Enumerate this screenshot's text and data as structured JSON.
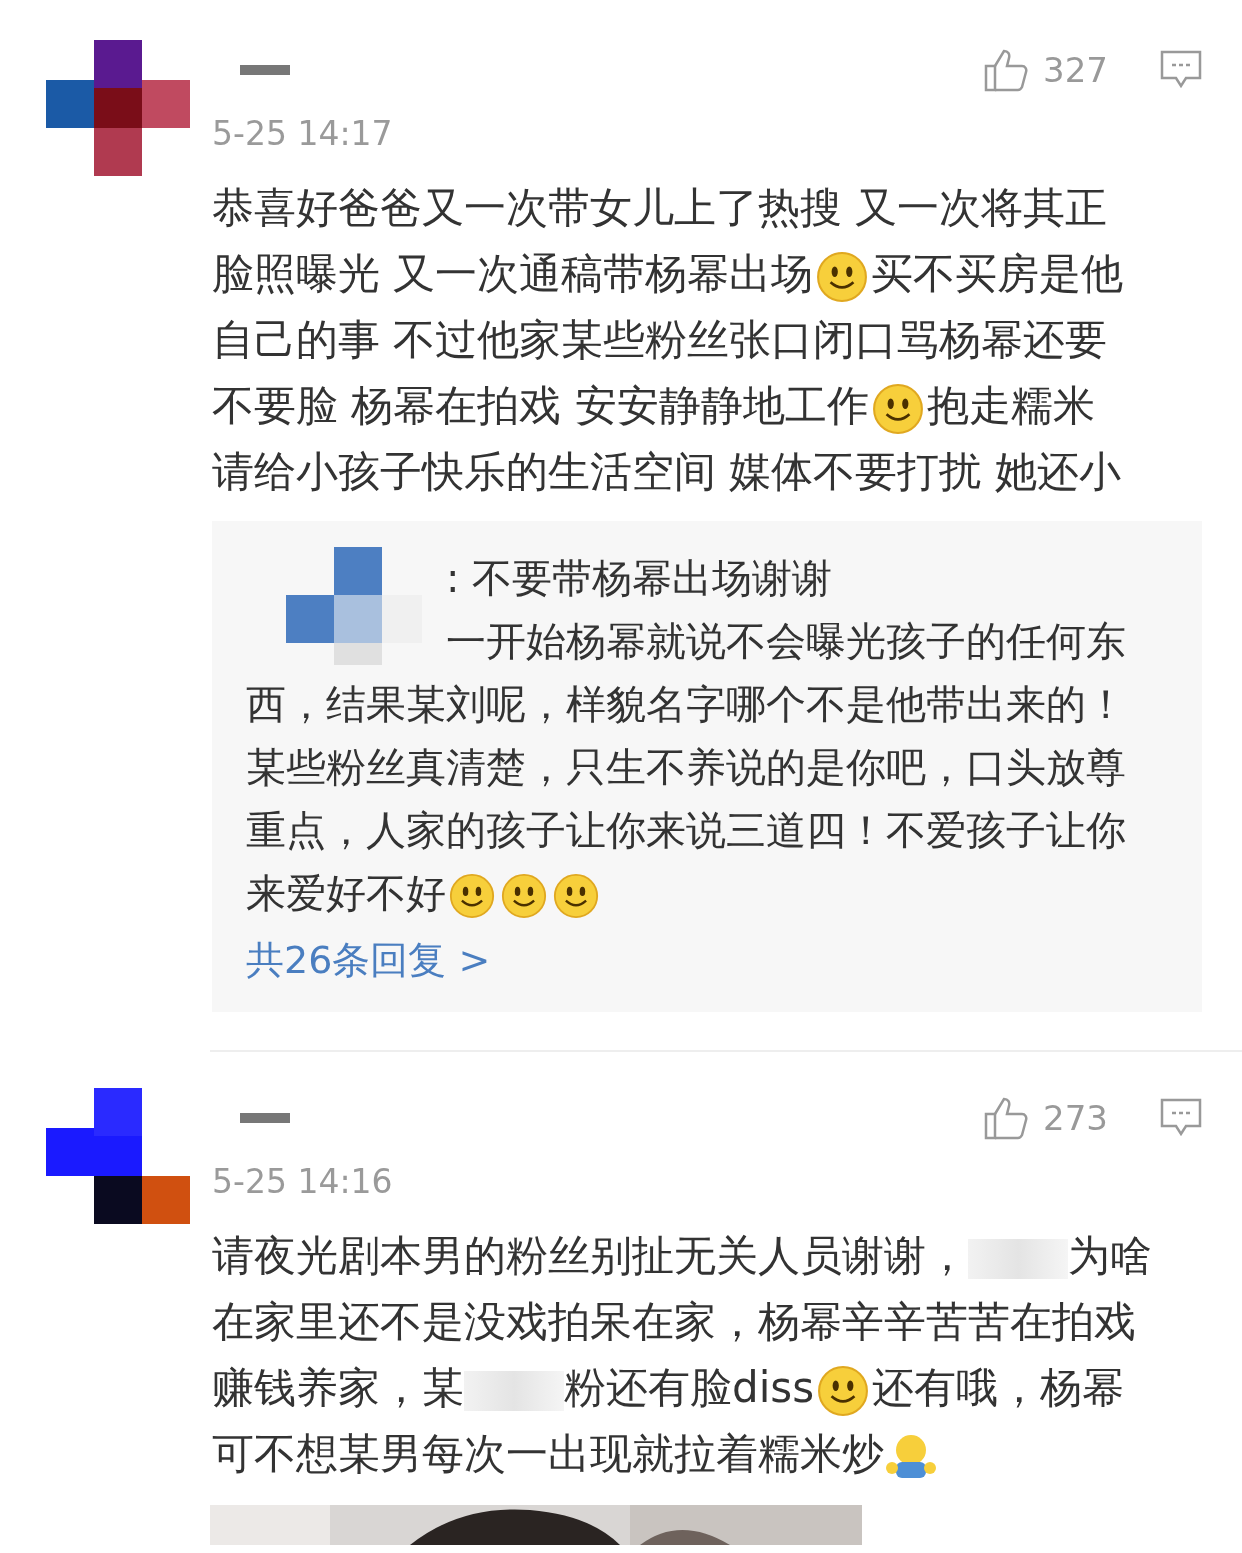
{
  "comments": [
    {
      "likes": "327",
      "time": "5-25 14:17",
      "lines": [
        [
          {
            "kind": "text",
            "text": "恭喜好爸爸又一次带女儿上了热搜 又一次将其正"
          }
        ],
        [
          {
            "kind": "text",
            "text": "脸照曝光 又一次通稿带杨幂出场"
          },
          {
            "kind": "smile"
          },
          {
            "kind": "text",
            "text": "买不买房是他"
          }
        ],
        [
          {
            "kind": "text",
            "text": "自己的事 不过他家某些粉丝张口闭口骂杨幂还要"
          }
        ],
        [
          {
            "kind": "text",
            "text": "不要脸 杨幂在拍戏 安安静静地工作"
          },
          {
            "kind": "smile"
          },
          {
            "kind": "text",
            "text": "抱走糯米"
          }
        ],
        [
          {
            "kind": "text",
            "text": "请给小孩子快乐的生活空间 媒体不要打扰 她还小"
          }
        ]
      ],
      "reply": {
        "lines": [
          [
            {
              "kind": "redaction"
            },
            {
              "kind": "text",
              "text": ": 不要带杨幂出场谢谢"
            }
          ],
          [
            {
              "kind": "text",
              "text": "一开始杨幂就说不会曝光孩子的任何东"
            }
          ],
          [
            {
              "kind": "text",
              "text": "西，结果某刘呢，样貌名字哪个不是他带出来的！"
            }
          ],
          [
            {
              "kind": "text",
              "text": "某些粉丝真清楚，只生不养说的是你吧，口头放尊"
            }
          ],
          [
            {
              "kind": "text",
              "text": "重点，人家的孩子让你来说三道四！不爱孩子让你"
            }
          ],
          [
            {
              "kind": "text",
              "text": "来爱好不好"
            },
            {
              "kind": "smile"
            },
            {
              "kind": "smile"
            },
            {
              "kind": "smile"
            }
          ]
        ],
        "more": "共26条回复 >"
      }
    },
    {
      "likes": "273",
      "time": "5-25 14:16",
      "lines": [
        [
          {
            "kind": "text",
            "text": "请夜光剧本男的粉丝别扯无关人员谢谢，"
          },
          {
            "kind": "redaction"
          },
          {
            "kind": "text",
            "text": "为啥"
          }
        ],
        [
          {
            "kind": "text",
            "text": "在家里还不是没戏拍呆在家，杨幂辛辛苦苦在拍戏"
          }
        ],
        [
          {
            "kind": "text",
            "text": "赚钱养家，某"
          },
          {
            "kind": "redaction"
          },
          {
            "kind": "text",
            "text": "粉还有脸diss"
          },
          {
            "kind": "smile"
          },
          {
            "kind": "text",
            "text": "还有哦，杨幂"
          }
        ],
        [
          {
            "kind": "text",
            "text": "可不想某男每次一出现就拉着糯米炒"
          },
          {
            "kind": "hug"
          }
        ]
      ]
    }
  ]
}
